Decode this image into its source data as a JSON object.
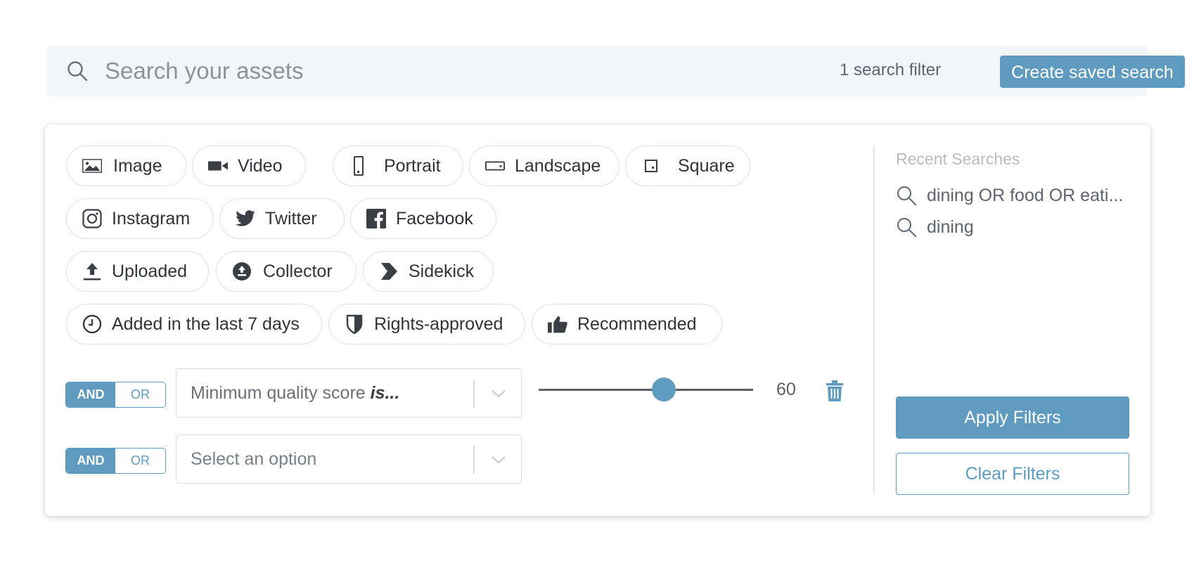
{
  "search": {
    "placeholder": "Search your assets",
    "filter_count": "1 search filter",
    "saved_search_label": "Create saved search"
  },
  "chips": {
    "image": "Image",
    "video": "Video",
    "portrait": "Portrait",
    "landscape": "Landscape",
    "square": "Square",
    "instagram": "Instagram",
    "twitter": "Twitter",
    "facebook": "Facebook",
    "uploaded": "Uploaded",
    "collector": "Collector",
    "sidekick": "Sidekick",
    "added_recent": "Added in the last 7 days",
    "rights_approved": "Rights-approved",
    "recommended": "Recommended"
  },
  "filters": [
    {
      "and_label": "AND",
      "or_label": "OR",
      "selected": "AND",
      "select_value_prefix": "Minimum quality score ",
      "select_value_emphasis": "is...",
      "slider_value": "60"
    },
    {
      "and_label": "AND",
      "or_label": "OR",
      "selected": "AND",
      "select_placeholder": "Select an option"
    }
  ],
  "recent": {
    "title": "Recent Searches",
    "items": [
      "dining OR food OR eati...",
      "dining"
    ]
  },
  "actions": {
    "apply_label": "Apply Filters",
    "clear_label": "Clear Filters"
  },
  "colors": {
    "accent": "#5e9bbf",
    "search_bg": "#f2f5f9",
    "chip_border": "#dde2e7"
  },
  "icons": {
    "search": "search-icon",
    "image": "image-icon",
    "video": "video-camera-icon",
    "portrait": "portrait-icon",
    "landscape": "landscape-icon",
    "square": "square-icon",
    "instagram": "instagram-icon",
    "twitter": "twitter-icon",
    "facebook": "facebook-icon",
    "uploaded": "upload-icon",
    "collector": "collector-icon",
    "sidekick": "sidekick-icon",
    "clock": "clock-icon",
    "shield": "shield-icon",
    "thumbs_up": "thumbs-up-icon",
    "chevron": "chevron-down-icon",
    "trash": "trash-icon"
  }
}
